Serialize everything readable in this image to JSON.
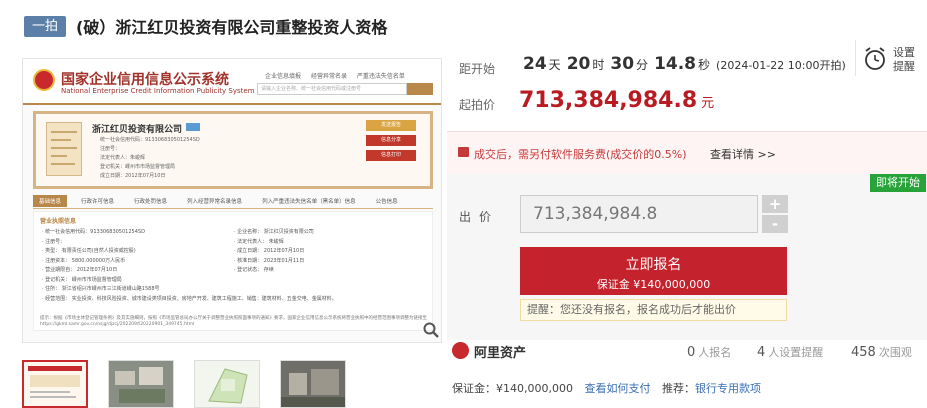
{
  "header": {
    "tag": "一拍",
    "title": "(破）浙江红贝投资有限公司重整投资人资格"
  },
  "image_panel": {
    "site_title": "国家企业信用信息公示系统",
    "site_subtitle": "National Enterprise Credit Information Publicity System",
    "top_links": [
      "企业信息填报",
      "经营异常名录",
      "严重违法失信名单"
    ],
    "search_placeholder": "请输入企业名称、统一社会信用代码或注册号",
    "company_name": "浙江红贝投资有限公司",
    "info_lines": [
      "统一社会信用代码：913306830501254SD",
      "注册号：",
      "法定代表人：朱峻辉",
      "登记机关：嵊州市市场监督管理局",
      "成立日期：2012年07月10日"
    ],
    "side_buttons": [
      "发送报告",
      "信息分享",
      "信息打印"
    ],
    "tabs": [
      "基础信息",
      "行政许可信息",
      "行政处罚信息",
      "列入经营异常名录信息",
      "列入严重违法失信名单（黑名单）信息",
      "公告信息"
    ],
    "section_title": "营业执照信息",
    "col_left": [
      "· 统一社会信用代码：913306830501254SD",
      "· 注册号：",
      "· 类型：  有限责任公司(自然人投资或控股)",
      "· 注册资本：  5800.000000万人民币",
      "· 营业期限自：  2012年07月10日",
      "· 登记机关：  嵊州市市场监督管理局",
      "· 住所：  浙江省绍兴市嵊州市三江街道嵊山路1588号",
      "· 经营范围：  实业投资、科技风险投资、城市建设类项目投资、房地产开发、建筑工程施工、销售：建筑材料、五金交电、金属材料。"
    ],
    "col_right": [
      "· 企业名称：  浙江红贝投资有限公司",
      "· 法定代表人：  朱峻辉",
      "· 成立日期：  2012年07月10日",
      "· 核准日期：  2023年01月11日",
      "· 登记状态：  存续"
    ],
    "note": "提示：根据《市场主体登记管理条例》及其实施细则，按照《市场监管总局办公厅关于调整营业执照照面事项的通知》要求，国家企业信用信息公示系统将营业执照中的经营范围事项调整为链接至https://gkml.samr.gov.cn/nsjg/djzcj/202209/t20220901_349745.html",
    "thumb_count": 4
  },
  "countdown": {
    "label": "距开始",
    "days": "24",
    "days_unit": "天",
    "hours": "20",
    "hours_unit": "时",
    "minutes": "30",
    "minutes_unit": "分",
    "seconds": "14.8",
    "seconds_unit": "秒",
    "start_time": "(2024-01-22 10:00开拍)"
  },
  "remind": {
    "label": "设置提醒"
  },
  "start_price": {
    "label": "起拍价",
    "value": "713,384,984.8",
    "unit": "元"
  },
  "fee_notice": {
    "text": "成交后，需另付软件服务费(成交价的0.5%)",
    "link": "查看详情 >>"
  },
  "bid": {
    "status_tag": "即将开始",
    "label": "出价",
    "value": "713,384,984.8",
    "plus": "+",
    "minus": "-",
    "apply_label": "立即报名",
    "deposit_line": "保证金 ¥140,000,000",
    "tip": "提醒：您还没有报名，报名成功后才能出价"
  },
  "stats": {
    "platform": "阿里资产",
    "signups": "0",
    "signups_label": "人报名",
    "reminders": "4",
    "reminders_label": "人设置提醒",
    "views": "458",
    "views_label": "次围观"
  },
  "deposit": {
    "label": "保证金：¥140,000,000",
    "link": "查看如何支付",
    "recommend_label": "推荐：",
    "recommend_link": "银行专用款项"
  },
  "colors": {
    "accent_red": "#c4222c",
    "price_red": "#b81c22",
    "status_green": "#27a33a",
    "link_blue": "#3a6fb5",
    "tag_blue": "#5b7fa6"
  }
}
